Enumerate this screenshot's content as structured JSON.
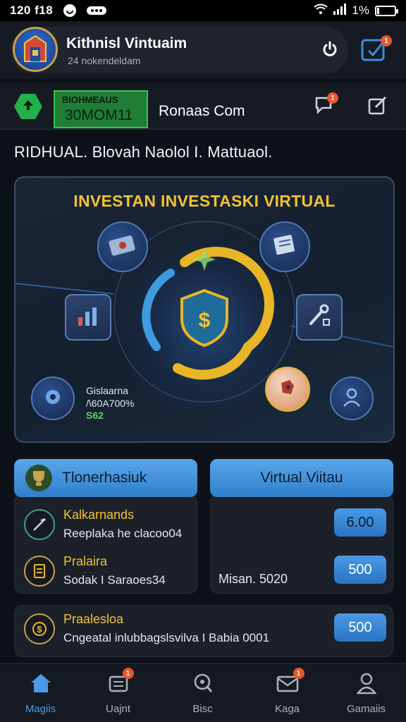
{
  "status_bar": {
    "time": "120 f18",
    "battery_text": "1%"
  },
  "header": {
    "title": "Kithnisl Vintuaim",
    "subtitle": "24 nokendeldam",
    "edit_badge": "1"
  },
  "subbar": {
    "green_label": "BIOHMEAUS",
    "green_value": "30MOM11",
    "room_title": "Ronaas Com",
    "chat_badge": "1"
  },
  "headline": "RIDHUAL. Blovah Naolol I. Mattuaol.",
  "hero": {
    "title": "INVESTAN INVESTASKI VIRTUAL",
    "stats_line1": "Gislaarna",
    "stats_line2": "/\\60A700%",
    "stats_line3": "S62"
  },
  "panel_left": {
    "header": "Tlonerhasiuk",
    "rows": [
      {
        "title": "Kalkarnands",
        "subtitle": "Reeplaka he clacoo04"
      },
      {
        "title": "Pralaira",
        "subtitle": "Sodak I Saraoes34"
      }
    ]
  },
  "panel_right": {
    "header": "Virtual Viitau",
    "btn1": "6.00",
    "btn2": "500",
    "note": "Misan. 5020"
  },
  "panel_bottom": {
    "title": "Praalesloa",
    "subtitle": "Cngeatal inlubbagslsvilva I Babia 0001",
    "btn": "500"
  },
  "bottom_nav": {
    "items": [
      {
        "label": "Magiis",
        "icon": "home-icon"
      },
      {
        "label": "Uajnt",
        "icon": "message-icon",
        "badge": "1"
      },
      {
        "label": "Bisc",
        "icon": "search-icon"
      },
      {
        "label": "Kaga",
        "icon": "mail-icon",
        "badge": "1"
      },
      {
        "label": "Gamaiis",
        "icon": "profile-icon"
      }
    ]
  },
  "colors": {
    "accent": "#4b9ae6",
    "gold": "#f1c232",
    "green": "#22b04a",
    "badge": "#e8552c",
    "background": "#0d1118"
  }
}
